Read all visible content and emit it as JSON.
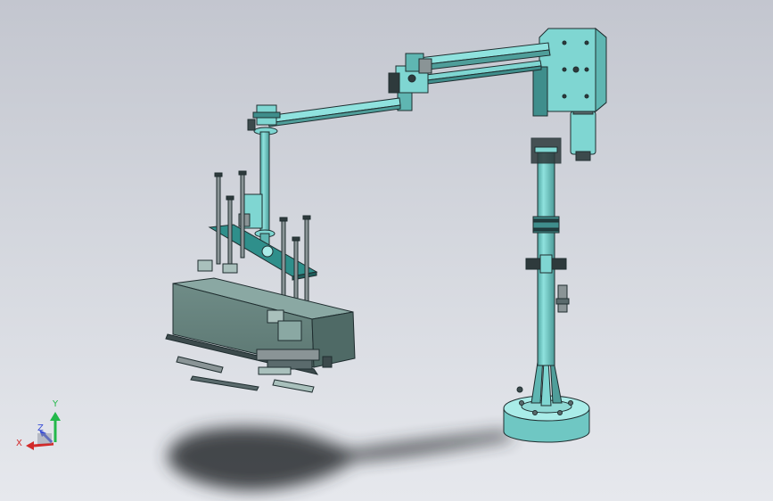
{
  "model": {
    "type": "pneumatic balancing manipulator arm",
    "colors": {
      "background_top": "#c3c6cf",
      "background_bottom": "#e6e8ed",
      "teal_body": "#7fd6d2",
      "teal_dark": "#3f8e8c",
      "teal_light": "#a9ece8",
      "gray_box": "#6f8c87",
      "gray_box_top": "#8aa8a3",
      "edge": "#1f2d2f",
      "shadow": "#2f3236",
      "cylinder_gray": "#8a9496"
    }
  },
  "triad": {
    "x_label": "X",
    "y_label": "Y",
    "z_label": "Z",
    "x_color": "#d22a2a",
    "y_color": "#23b84a",
    "z_color": "#3a4fd6"
  }
}
